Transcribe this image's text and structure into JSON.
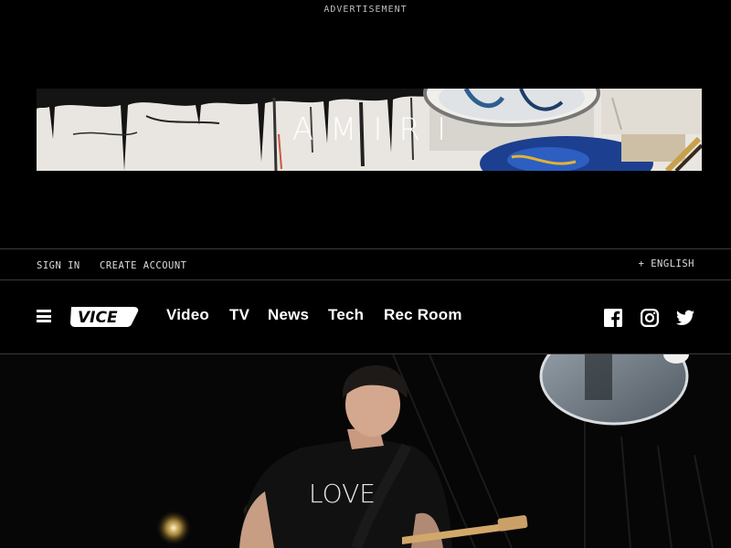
{
  "ad": {
    "label": "ADVERTISEMENT",
    "brand": "AMIRI"
  },
  "account_bar": {
    "sign_in": "SIGN IN",
    "create_account": "CREATE ACCOUNT",
    "language": "+ ENGLISH"
  },
  "nav": {
    "logo": "VICE",
    "items": [
      {
        "label": "Video"
      },
      {
        "label": "TV"
      },
      {
        "label": "News"
      },
      {
        "label": "Tech"
      },
      {
        "label": "Rec Room"
      }
    ],
    "social_icons": [
      "facebook-icon",
      "instagram-icon",
      "twitter-icon"
    ]
  },
  "hero": {
    "shirt_text": "LOVE"
  },
  "colors": {
    "background": "#000000",
    "divider": "#3a3a3a",
    "text": "#ffffff"
  }
}
